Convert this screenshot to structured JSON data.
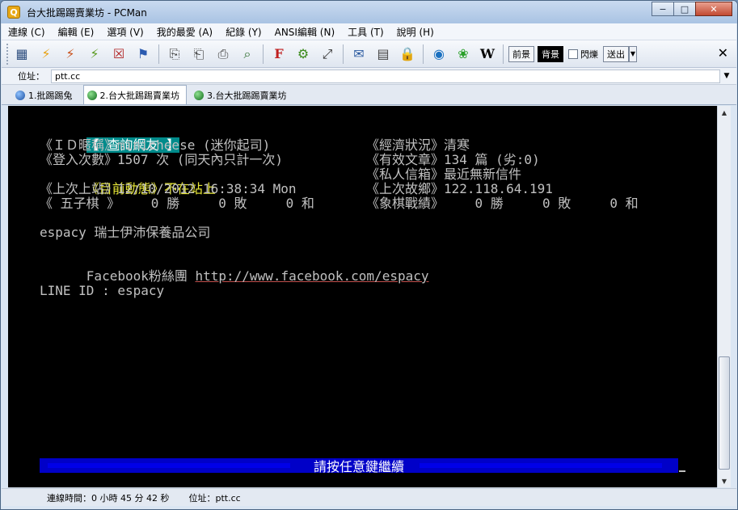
{
  "window": {
    "title": "台大批踢踢賣業坊 - PCMan"
  },
  "menu": [
    "連線 (C)",
    "編輯 (E)",
    "選項 (V)",
    "我的最愛 (A)",
    "紀錄 (Y)",
    "ANSI編輯 (N)",
    "工具 (T)",
    "說明 (H)"
  ],
  "toolbar": {
    "fg_label": "前景",
    "bg_label": "背景",
    "blink_label": "閃爍",
    "send_label": "送出"
  },
  "address": {
    "label": "位址：",
    "value": "ptt.cc"
  },
  "tabs": [
    {
      "label": "1.批踢踢兔",
      "color": "blue"
    },
    {
      "label": "2.台大批踢踢賣業坊",
      "color": "green",
      "active": true
    },
    {
      "label": "3.台大批踢踢賣業坊",
      "color": "green"
    }
  ],
  "terminal": {
    "header": "【 查詢網友 】",
    "row1_left": "《ＩＤ暱稱》minicheese (迷你起司)",
    "row1_right": "《經濟狀況》清寒",
    "row2_left": "《登入次數》1507 次 (同天內只計一次)",
    "row2_right": "《有效文章》134 篇 (劣:0)",
    "row3_left_label": "《目前動態》",
    "row3_left_value": "不在站上",
    "row3_right": "《私人信箱》最近無新信件",
    "row4_left": "《上次上站》12/10/2012 16:38:34 Mon",
    "row4_right": "《上次故鄉》122.118.64.191",
    "row5_left": "《 五子棋 》    0 勝     0 敗     0 和",
    "row5_right": "《象棋戰績》    0 勝     0 敗     0 和",
    "plan_line1": "espacy 瑞士伊沛保養品公司",
    "plan_line2_prefix": "Facebook粉絲團 ",
    "plan_line2_link": "http://www.facebook.com/espacy",
    "plan_line3": "LINE ID : espacy",
    "press_any_key": "請按任意鍵繼續"
  },
  "status": {
    "connection_time": "連線時間：0 小時 45 分 42 秒",
    "address": "位址：ptt.cc"
  }
}
